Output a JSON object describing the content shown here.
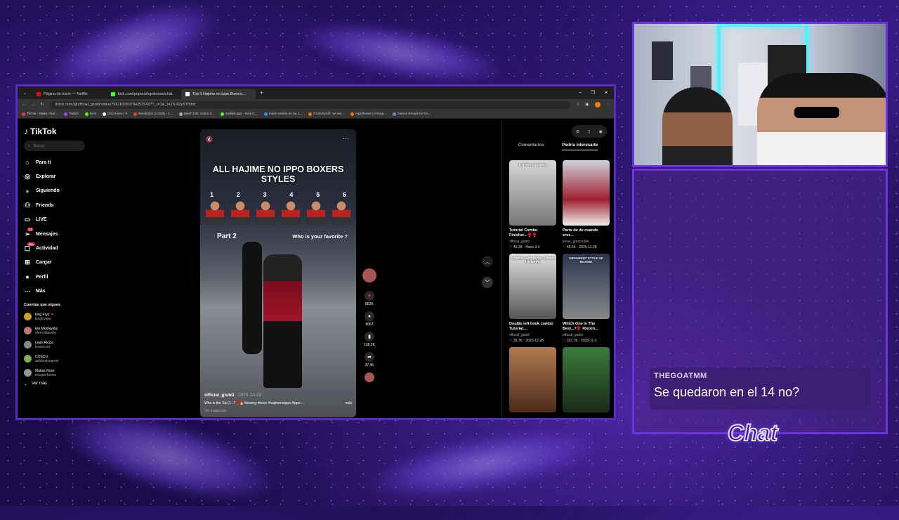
{
  "browser": {
    "tabs": [
      {
        "label": "Página de inicio — Netflix",
        "color": "#e50914"
      },
      {
        "label": "kick.com/popout/hgrdnoise/chat",
        "color": "#53fc18"
      },
      {
        "label": "Top 3 Hajime no Ippo Boxers...",
        "color": "#ffffff"
      }
    ],
    "new_tab": "+",
    "url": "tiktok.com/@official_giubti/video/7561833597842525427?_r=1&_t=ZS-92yBTf5tlzt",
    "bookmarks": [
      "TikTok - Make Your...",
      "Twitch",
      "Kick",
      "(21) Inicio / X",
      "Recibidos (3,628) - c...",
      "twitch bits: botón d...",
      "Kicklet.app - Kick C...",
      "Inicie sesión en su c...",
      "Crunchyroll: Ve ani...",
      "HgrdNoise | Group...",
      "Dance Emojis for Di..."
    ]
  },
  "tiktok": {
    "logo": "TikTok",
    "search_placeholder": "Buscar",
    "nav": [
      {
        "label": "Para ti",
        "icon": "home-icon"
      },
      {
        "label": "Explorar",
        "icon": "compass-icon"
      },
      {
        "label": "Siguiendo",
        "icon": "following-icon"
      },
      {
        "label": "Friends",
        "icon": "friends-icon"
      },
      {
        "label": "LIVE",
        "icon": "live-icon"
      },
      {
        "label": "Mensajes",
        "icon": "messages-icon",
        "badge": "27"
      },
      {
        "label": "Actividad",
        "icon": "activity-icon",
        "badge": "99+"
      },
      {
        "label": "Cargar",
        "icon": "upload-icon"
      },
      {
        "label": "Perfil",
        "icon": "profile-icon"
      },
      {
        "label": "Más",
        "icon": "more-icon"
      }
    ],
    "following_header": "Cuentas que sigues",
    "following": [
      {
        "name": "king Frys 🔻",
        "handle": "kingfryspe"
      },
      {
        "name": "Elo Moldavsky",
        "handle": "elomoldavsky"
      },
      {
        "name": "Lean Riccio",
        "handle": "leanriccio"
      },
      {
        "name": "COSCU",
        "handle": "adictoalvegetal"
      },
      {
        "name": "Matias Ross",
        "handle": "rossperfumes"
      }
    ],
    "see_more": "Ver más",
    "video": {
      "title": "ALL HAJIME NO IPPO BOXERS STYLES",
      "numbers": [
        "1",
        "2",
        "3",
        "4",
        "5",
        "6"
      ],
      "part": "Part 2",
      "question": "Who is your favorite ?",
      "username": "official_giubti",
      "date": "· 2025-10-16",
      "description": "Who is the Top 3...?🥊🔥#boxing #boxe #hajimenoippo #ippo ...",
      "more": "más",
      "translate": "Ver traducción"
    },
    "actions": {
      "likes": "862K",
      "comments": "8067",
      "saves": "128.2K",
      "shares": "27.4K"
    },
    "right_tabs": [
      "Comentarios",
      "Podría interesarte"
    ],
    "suggested": [
      {
        "thumb": "TUTORIAL COMBO",
        "title": "Tutorial Combo Finisher...🥊🥊",
        "author": "official_giubti",
        "meta": "♡ 49.2K · Hace 3 d"
      },
      {
        "thumb": "",
        "title": "Parte de de cuando eres...",
        "author": "jesus_garcinoble",
        "meta": "♡ 48.5K · 2025-11-28"
      },
      {
        "thumb": "DOUBLE LEFT HOOK COMBO TUTORIAL",
        "title": "Double left hook combo Tutorial....",
        "author": "official_giubti",
        "meta": "♡ 35.7K · 2025-12-28"
      },
      {
        "thumb": "DIFFERENT STYLE OF BOXING",
        "title": "Which One Is The Best...?🥊 #boxin...",
        "author": "official_giubti",
        "meta": "♡ 322.7K · 2025-11-2"
      },
      {
        "thumb": "",
        "title": "",
        "author": "",
        "meta": ""
      },
      {
        "thumb": "",
        "title": "",
        "author": "",
        "meta": ""
      }
    ]
  },
  "chat": {
    "user": "THEGOATMM",
    "message": "Se quedaron en el 14 no?",
    "label": "Chat"
  }
}
